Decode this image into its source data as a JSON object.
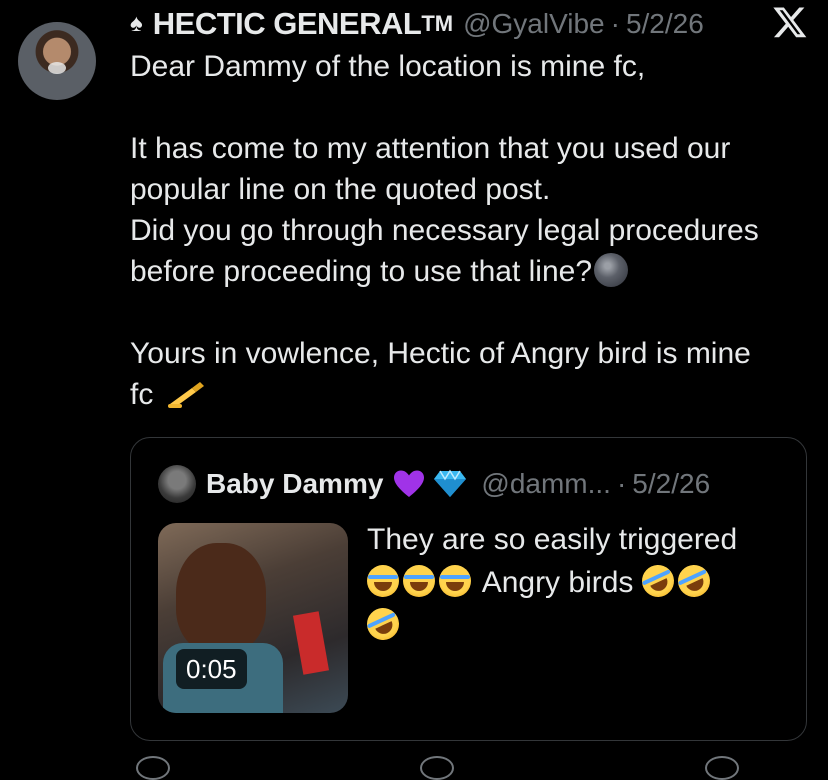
{
  "post": {
    "symbol": "♠",
    "display_name": "HECTIC GENERAL",
    "trademark": "TM",
    "handle": "@GyalVibe",
    "separator": "·",
    "date": "5/2/26",
    "body": {
      "line1": "Dear Dammy of the location is mine fc,",
      "line2": "It has come to my attention that you used our",
      "line3": "popular line on the quoted post.",
      "line4": "Did you go through necessary legal procedures",
      "line5": "before proceeding to use that line?",
      "line6": "Yours in vowlence, Hectic of Angry bird is mine",
      "line7": "fc"
    }
  },
  "quoted": {
    "display_name": "Baby Dammy",
    "handle": "@damm...",
    "separator": "·",
    "date": "5/2/26",
    "video_duration": "0:05",
    "text": {
      "line1": "They are so easily triggered",
      "line2": "Angry birds"
    }
  },
  "icons": {
    "platform": "x-logo",
    "emoji_moon": "new-moon-face",
    "emoji_writing": "writing-hand",
    "emoji_laugh": "face-with-tears-of-joy",
    "emoji_rofl": "rolling-on-floor-laughing",
    "badge_heart": "purple-heart",
    "badge_gem": "gem"
  },
  "colors": {
    "background": "#000000",
    "text": "#e7e9ea",
    "secondary": "#71767b",
    "border": "#333639"
  }
}
